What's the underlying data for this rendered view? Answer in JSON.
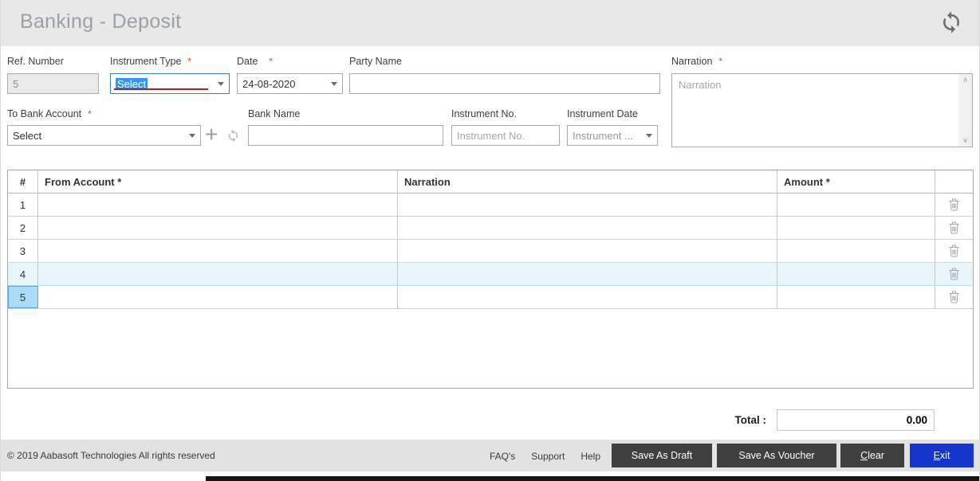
{
  "window": {
    "title": "Banking - Deposit"
  },
  "icons": {
    "header_refresh": "sync-icon",
    "add": "+",
    "combo_refresh": "refresh-icon",
    "delete": "trash-icon",
    "scroll_up": "∧",
    "scroll_down": "∨"
  },
  "form": {
    "ref_number": {
      "label": "Ref. Number",
      "value": "5"
    },
    "instrument_type": {
      "label": "Instrument Type",
      "required": "*",
      "selected": "Select"
    },
    "date": {
      "label": "Date",
      "required": "*",
      "value": "24-08-2020"
    },
    "party_name": {
      "label": "Party Name",
      "value": ""
    },
    "narration": {
      "label": "Narration",
      "required": "*",
      "placeholder": "Narration"
    },
    "to_bank_account": {
      "label": "To Bank Account",
      "required": "*",
      "selected": "Select"
    },
    "bank_name": {
      "label": "Bank Name",
      "value": ""
    },
    "instrument_no": {
      "label": "Instrument No.",
      "placeholder": "Instrument No."
    },
    "instrument_date": {
      "label": "Instrument Date",
      "placeholder": "Instrument ..."
    }
  },
  "grid": {
    "columns": [
      {
        "label": "#"
      },
      {
        "label": "From Account *"
      },
      {
        "label": "Narration"
      },
      {
        "label": "Amount *"
      },
      {
        "label": ""
      }
    ],
    "rows": [
      {
        "index": "1",
        "from_account": "",
        "narration": "",
        "amount": ""
      },
      {
        "index": "2",
        "from_account": "",
        "narration": "",
        "amount": ""
      },
      {
        "index": "3",
        "from_account": "",
        "narration": "",
        "amount": ""
      },
      {
        "index": "4",
        "from_account": "",
        "narration": "",
        "amount": ""
      },
      {
        "index": "5",
        "from_account": "",
        "narration": "",
        "amount": ""
      }
    ],
    "highlighted_row": "4",
    "selected_row": "5"
  },
  "total": {
    "label": "Total :",
    "value": "0.00"
  },
  "footer": {
    "copyright": "© 2019 Aabasoft Technologies All rights reserved",
    "links": [
      {
        "label": "FAQ's"
      },
      {
        "label": "Support"
      },
      {
        "label": "Help"
      }
    ],
    "buttons": {
      "save_draft": "Save As Draft",
      "save_voucher": "Save As Voucher",
      "clear_accel": "C",
      "clear_rest": "lear",
      "exit_accel": "E",
      "exit_rest": "xit"
    }
  },
  "colors": {
    "header_bg": "#e8e8e8",
    "title_text": "#9aa0a5",
    "required_red": "#e04a45",
    "error_underline": "#b02418",
    "selection_blue": "#3296fb",
    "focus_border": "#3d7dc2",
    "row_highlight": "#e9f5fd",
    "cell_selected": "#abdbf7",
    "button_dark": "#3f3f3f",
    "exit_blue": "#1535cd",
    "footer_bg": "#e2e2e2"
  }
}
